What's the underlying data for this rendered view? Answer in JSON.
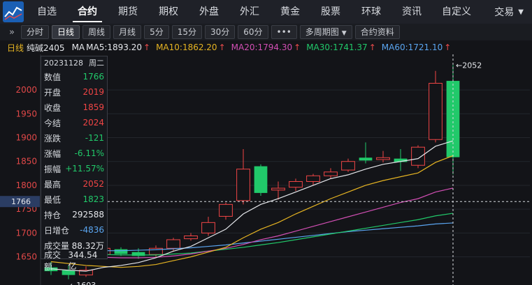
{
  "nav": {
    "items": [
      "自选",
      "合约",
      "期货",
      "期权",
      "外盘",
      "外汇",
      "黄金",
      "股票",
      "环球",
      "资讯",
      "自定义"
    ],
    "active_index": 1,
    "more_label": "交易"
  },
  "toolbar": {
    "periods": [
      "分时",
      "日线",
      "周线",
      "月线",
      "5分",
      "15分",
      "30分",
      "60分"
    ],
    "active_index": 1,
    "more_label": "•••",
    "multi_period_label": "多周期图",
    "contract_info_label": "合约资料"
  },
  "legend": {
    "period": "日线",
    "contract": "纯碱2405",
    "ma_label": "MA",
    "ma5": "MA5:1893.20",
    "ma10": "MA10:1862.20",
    "ma20": "MA20:1794.30",
    "ma30": "MA30:1741.37",
    "ma60": "MA60:1721.10"
  },
  "colors": {
    "up": "#f04545",
    "down": "#21c96a",
    "ma5": "#e5e7eb",
    "ma10": "#e6b422",
    "ma20": "#d24fb4",
    "ma30": "#21c96a",
    "ma60": "#5aa5f0"
  },
  "info": {
    "date": "20231128",
    "weekday": "周二",
    "rows": [
      {
        "label": "数值",
        "value": "1766",
        "tone": "green"
      },
      {
        "label": "开盘",
        "value": "2019",
        "tone": "red"
      },
      {
        "label": "收盘",
        "value": "1859",
        "tone": "red"
      },
      {
        "label": "今结",
        "value": "2024",
        "tone": "red"
      },
      {
        "label": "涨跌",
        "value": "-121",
        "tone": "green"
      },
      {
        "label": "涨幅",
        "value": "-6.11%",
        "tone": "green"
      },
      {
        "label": "振幅",
        "value": "+11.57%",
        "tone": "green"
      },
      {
        "label": "最高",
        "value": "2052",
        "tone": "red"
      },
      {
        "label": "最低",
        "value": "1823",
        "tone": "green"
      },
      {
        "label": "持仓",
        "value": "292588",
        "tone": "white"
      },
      {
        "label": "日增仓",
        "value": "-4836",
        "tone": "blue"
      },
      {
        "label": "成交量",
        "value": "88.32万",
        "tone": "white"
      },
      {
        "label": "成交额",
        "value": "344.54亿",
        "tone": "white"
      }
    ]
  },
  "chart_data": {
    "type": "candlestick",
    "y_ticks": [
      1650,
      1700,
      1750,
      1800,
      1850,
      1900,
      1950,
      2000
    ],
    "ylim": [
      1610,
      2060
    ],
    "crosshair_value": 1766,
    "crosshair_label": "1766",
    "high_marker": "2052",
    "low_marker": "1603",
    "candles": [
      {
        "o": 1628,
        "c": 1620,
        "h": 1640,
        "l": 1612
      },
      {
        "o": 1622,
        "c": 1612,
        "h": 1632,
        "l": 1603
      },
      {
        "o": 1612,
        "c": 1622,
        "h": 1630,
        "l": 1608
      },
      {
        "o": 1655,
        "c": 1668,
        "h": 1672,
        "l": 1645
      },
      {
        "o": 1666,
        "c": 1656,
        "h": 1670,
        "l": 1652
      },
      {
        "o": 1660,
        "c": 1652,
        "h": 1668,
        "l": 1646
      },
      {
        "o": 1655,
        "c": 1668,
        "h": 1674,
        "l": 1650
      },
      {
        "o": 1668,
        "c": 1686,
        "h": 1690,
        "l": 1662
      },
      {
        "o": 1688,
        "c": 1694,
        "h": 1700,
        "l": 1684
      },
      {
        "o": 1700,
        "c": 1722,
        "h": 1734,
        "l": 1694
      },
      {
        "o": 1735,
        "c": 1760,
        "h": 1764,
        "l": 1728
      },
      {
        "o": 1768,
        "c": 1834,
        "h": 1876,
        "l": 1760
      },
      {
        "o": 1840,
        "c": 1784,
        "h": 1844,
        "l": 1778
      },
      {
        "o": 1790,
        "c": 1794,
        "h": 1808,
        "l": 1770
      },
      {
        "o": 1796,
        "c": 1808,
        "h": 1814,
        "l": 1788
      },
      {
        "o": 1808,
        "c": 1820,
        "h": 1824,
        "l": 1800
      },
      {
        "o": 1820,
        "c": 1828,
        "h": 1836,
        "l": 1814
      },
      {
        "o": 1832,
        "c": 1850,
        "h": 1856,
        "l": 1828
      },
      {
        "o": 1858,
        "c": 1852,
        "h": 1890,
        "l": 1846
      },
      {
        "o": 1854,
        "c": 1858,
        "h": 1872,
        "l": 1848
      },
      {
        "o": 1856,
        "c": 1849,
        "h": 1876,
        "l": 1830
      },
      {
        "o": 1842,
        "c": 1880,
        "h": 1884,
        "l": 1836
      },
      {
        "o": 1896,
        "c": 2014,
        "h": 2040,
        "l": 1890
      },
      {
        "o": 2019,
        "c": 1859,
        "h": 2052,
        "l": 1823
      }
    ],
    "ma5": [
      1625,
      1622,
      1620,
      1628,
      1632,
      1638,
      1648,
      1662,
      1672,
      1690,
      1708,
      1740,
      1760,
      1772,
      1786,
      1800,
      1814,
      1822,
      1834,
      1844,
      1850,
      1856,
      1882,
      1893.2
    ],
    "ma10": [
      1640,
      1636,
      1632,
      1630,
      1628,
      1630,
      1634,
      1642,
      1650,
      1660,
      1670,
      1690,
      1708,
      1722,
      1740,
      1756,
      1772,
      1786,
      1800,
      1810,
      1818,
      1826,
      1848,
      1862.2
    ],
    "ma20": [
      1655,
      1652,
      1650,
      1649,
      1648,
      1648,
      1649,
      1652,
      1656,
      1662,
      1668,
      1676,
      1686,
      1694,
      1704,
      1714,
      1724,
      1734,
      1744,
      1754,
      1764,
      1772,
      1786,
      1794.3
    ],
    "ma30": [
      1660,
      1658,
      1656,
      1655,
      1654,
      1654,
      1654,
      1656,
      1658,
      1662,
      1666,
      1670,
      1675,
      1680,
      1686,
      1692,
      1698,
      1704,
      1710,
      1716,
      1722,
      1728,
      1736,
      1741.37
    ],
    "ma60": [
      1665,
      1664,
      1663,
      1663,
      1663,
      1664,
      1665,
      1667,
      1669,
      1672,
      1675,
      1679,
      1683,
      1687,
      1691,
      1695,
      1699,
      1703,
      1706,
      1709,
      1712,
      1715,
      1719,
      1721.1
    ]
  }
}
